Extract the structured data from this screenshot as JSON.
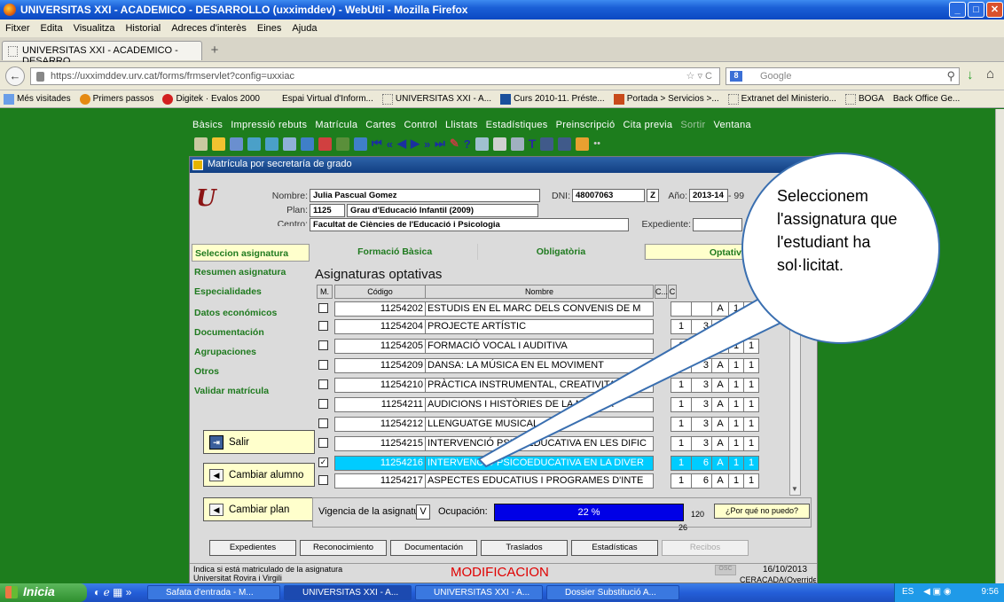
{
  "window": {
    "title": "UNIVERSITAS XXI - ACADEMICO - DESARROLLO (uxximddev) - WebUtil - Mozilla Firefox"
  },
  "browser": {
    "menu": [
      "Fitxer",
      "Edita",
      "Visualitza",
      "Historial",
      "Adreces d'interès",
      "Eines",
      "Ajuda"
    ],
    "tab_label": "UNIVERSITAS XXI - ACADEMICO - DESARRO...",
    "url": "https://uxximddev.urv.cat/forms/frmservlet?config=uxxiac",
    "search_placeholder": "Google",
    "bookmarks": [
      "Més visitades",
      "Primers passos",
      "Digitek · Evalos 2000",
      "Espai Virtual d'Inform...",
      "UNIVERSITAS XXI - A...",
      "Curs 2010-11. Préste...",
      "Portada > Servicios >...",
      "Extranet del Ministerio...",
      "BOGA",
      "Back Office Ge..."
    ]
  },
  "app": {
    "menu": [
      "Bàsics",
      "Impressió rebuts",
      "Matrícula",
      "Cartes",
      "Control",
      "Llistats",
      "Estadístiques",
      "Preinscripció",
      "Cita previa",
      "Sortir",
      "Ventana"
    ],
    "form_title": "Matrícula por secretaría de grado",
    "header": {
      "nombre_label": "Nombre:",
      "nombre": "Julia Pascual Gomez",
      "dni_label": "DNI:",
      "dni": "48007063",
      "dni_letter": "Z",
      "anyo_label": "Año:",
      "anyo": "2013-14",
      "anyo2": "- 99",
      "plan_label": "Plan:",
      "plan_code": "1125",
      "plan_name": "Grau d'Educació Infantil (2009)",
      "centro_label": "Centro:",
      "centro": "Facultat de Ciències de l'Educació i Psicologia",
      "expediente_label": "Expediente:"
    },
    "left_nav": [
      "Seleccion asignatura",
      "Resumen asignatura",
      "Especialidades",
      "Datos económicos",
      "Documentación",
      "Agrupaciones",
      "Otros",
      "Validar matrícula"
    ],
    "side_buttons": {
      "salir": "Salir",
      "cambiar_alumno": "Cambiar alumno",
      "cambiar_plan": "Cambiar plan"
    },
    "tabs": [
      "Formació Bàsica",
      "Obligatòria",
      "Optativa"
    ],
    "section_title": "Asignaturas optativas",
    "columns": [
      "M.",
      "Código",
      "Nombre",
      "C...",
      "C"
    ],
    "rows": [
      {
        "checked": false,
        "code": "11254202",
        "name": "ESTUDIS EN EL MARC DELS CONVENIS DE M",
        "a": "",
        "b": "",
        "c": "A",
        "d": "1",
        "e": "1"
      },
      {
        "checked": false,
        "code": "11254204",
        "name": "PROJECTE ARTÍSTIC",
        "a": "1",
        "b": "3",
        "c": "A",
        "d": "1",
        "e": "1"
      },
      {
        "checked": false,
        "code": "11254205",
        "name": "FORMACIÓ VOCAL I AUDITIVA",
        "a": "1",
        "b": "3",
        "c": "A",
        "d": "1",
        "e": "1"
      },
      {
        "checked": false,
        "code": "11254209",
        "name": "DANSA: LA MÚSICA EN EL MOVIMENT",
        "a": "1",
        "b": "3",
        "c": "A",
        "d": "1",
        "e": "1"
      },
      {
        "checked": false,
        "code": "11254210",
        "name": "PRÀCTICA INSTRUMENTAL, CREATIVITAT I IMP",
        "a": "1",
        "b": "3",
        "c": "A",
        "d": "1",
        "e": "1"
      },
      {
        "checked": false,
        "code": "11254211",
        "name": "AUDICIONS I HISTÒRIES DE LA MÚSICA",
        "a": "1",
        "b": "3",
        "c": "A",
        "d": "1",
        "e": "1"
      },
      {
        "checked": false,
        "code": "11254212",
        "name": "LLENGUATGE MUSICAL",
        "a": "1",
        "b": "3",
        "c": "A",
        "d": "1",
        "e": "1"
      },
      {
        "checked": false,
        "code": "11254215",
        "name": "INTERVENCIÓ PSICOEDUCATIVA EN LES DIFIC",
        "a": "1",
        "b": "3",
        "c": "A",
        "d": "1",
        "e": "1"
      },
      {
        "checked": true,
        "code": "11254216",
        "name": "INTERVENCIÓ PSICOEDUCATIVA EN LA DIVER",
        "a": "1",
        "b": "6",
        "c": "A",
        "d": "1",
        "e": "1"
      },
      {
        "checked": false,
        "code": "11254217",
        "name": "ASPECTES EDUCATIUS I PROGRAMES D'INTE",
        "a": "1",
        "b": "6",
        "c": "A",
        "d": "1",
        "e": "1"
      }
    ],
    "vigencia_label": "Vigencia de la asignatura:",
    "vigencia_value": "V",
    "ocupacion_label": "Ocupación:",
    "ocupacion_value": "22 %",
    "ocupacion_fraction": 0.22,
    "count_top": "120",
    "count_bottom": "26",
    "porque_button": "¿Por qué no puedo?",
    "bottom_buttons": [
      "Expedientes",
      "Reconocimiento",
      "Documentación",
      "Traslados",
      "Estadísticas",
      "Recibos"
    ],
    "status": {
      "hint": "Indica si está matriculado de la asignatura",
      "univ": "Universitat Rovira i Virgili",
      "mode": "MODIFICACION",
      "date": "16/10/2013",
      "small": "OSC",
      "user": "CERACADA(Overrides)"
    }
  },
  "callout": {
    "text": "Seleccionem l'assignatura que l'estudiant ha sol·licitat."
  },
  "taskbar": {
    "start": "Inicia",
    "tasks": [
      "Safata d'entrada - M...",
      "UNIVERSITAS XXI - A...",
      "UNIVERSITAS XXI - A...",
      "Dossier Substitució A..."
    ],
    "lang": "ES",
    "clock": "9:56"
  },
  "colors": {
    "page_bg": "#1d7d1d",
    "accent_selected": "#00ccff",
    "bar": "#0000e6",
    "yellow": "#ffffcc",
    "nav_green": "#1f7a1f",
    "mode_red": "#e00000"
  }
}
